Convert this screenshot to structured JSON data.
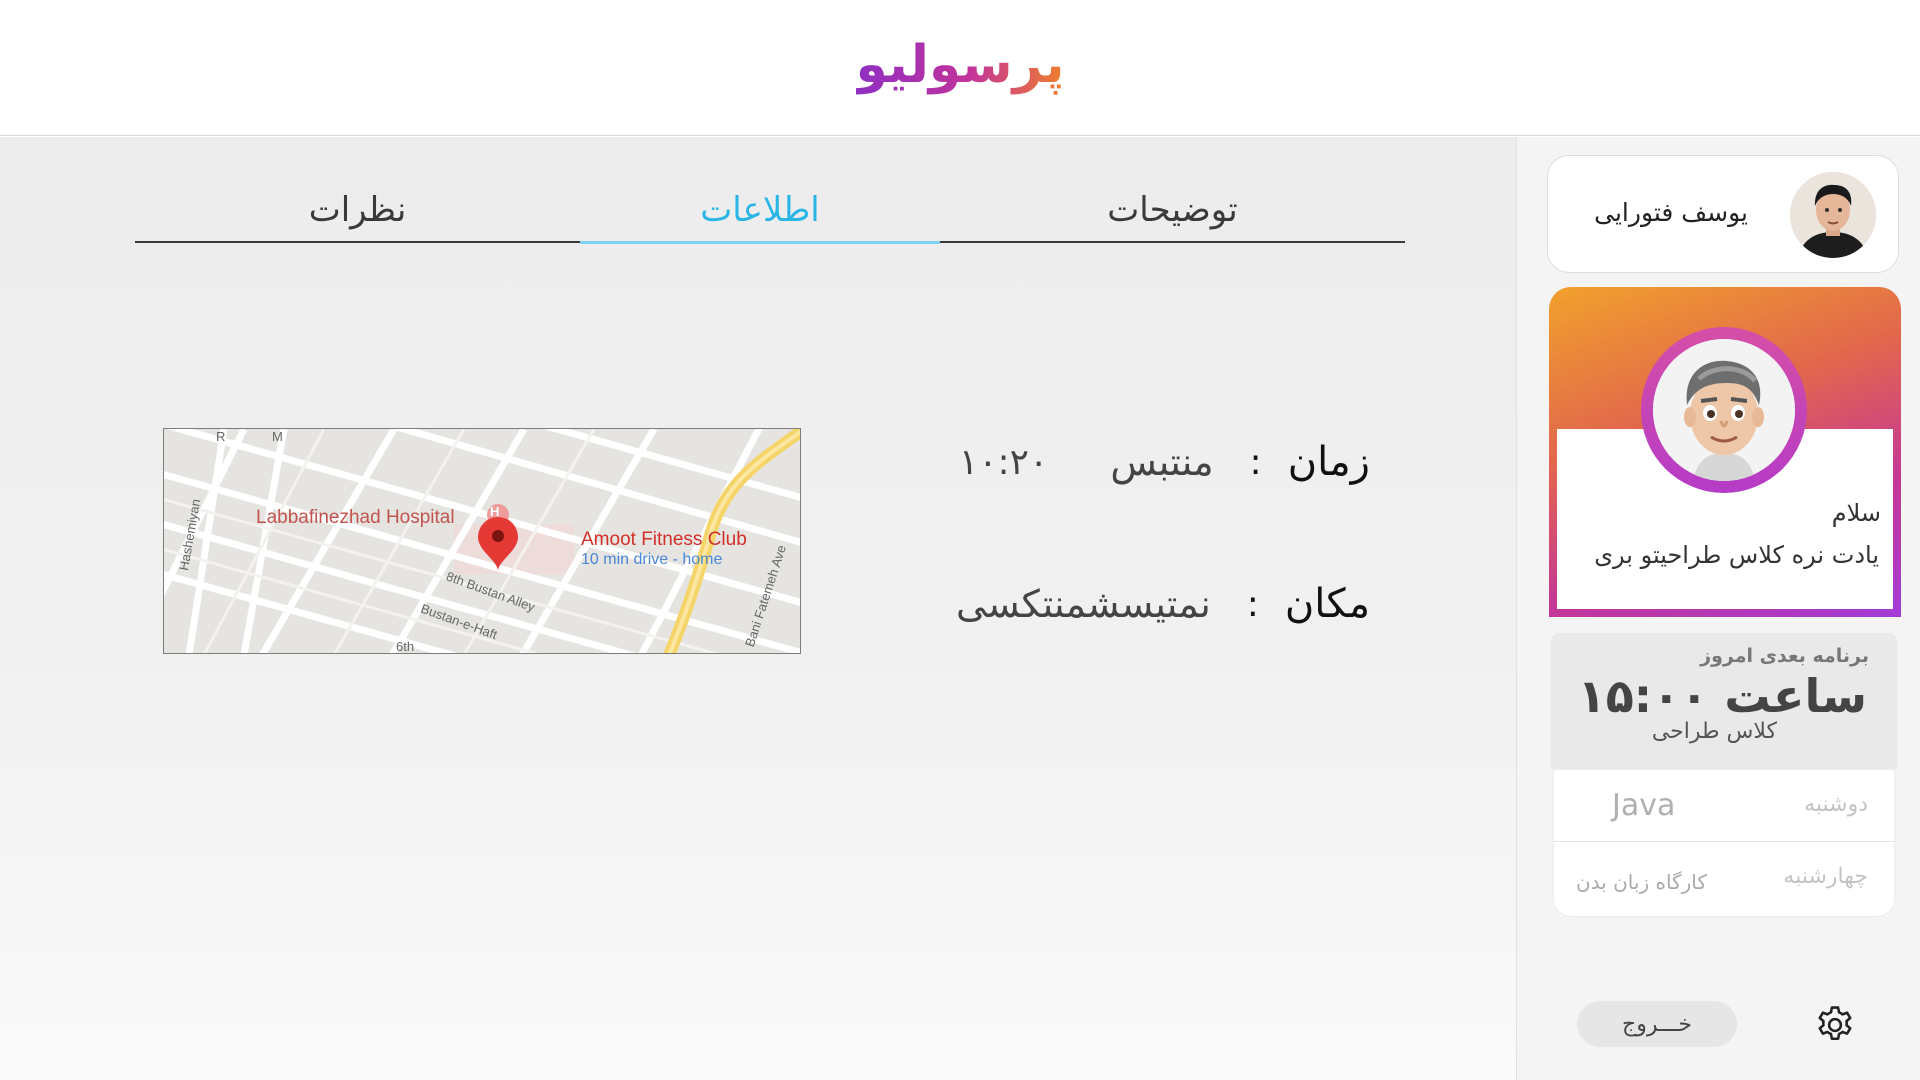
{
  "header": {
    "logo_text": "پرسولیو"
  },
  "tabs": [
    {
      "label": "نظرات"
    },
    {
      "label": "اطلاعات"
    },
    {
      "label": "توضیحات"
    }
  ],
  "info": {
    "time_label": "زمان",
    "time_value": "منتبس",
    "time_clock": "۱۰:۲۰",
    "place_label": "مکان",
    "place_value": "نمتیسشمنتکسی",
    "separator": ":"
  },
  "map": {
    "hospital_label": "Labbafinezhad Hospital",
    "hospital_badge": "H",
    "destination_label": "Amoot Fitness Club",
    "drive_label": "10 min drive - home",
    "streets": [
      "Hashemiyan",
      "8th Bustan Alley",
      "Bustan-e-Haft",
      "Bani Fatemeh Ave",
      "6th",
      "R",
      "M"
    ]
  },
  "sidebar": {
    "user_name": "یوسف فتورایی",
    "promo_hello": "سلام",
    "promo_message": "یادت نره کلاس طراحیتو بری",
    "next_label": "برنامه بعدی امروز",
    "next_time": "ساعت ۱۵:۰۰",
    "next_class": "کلاس طراحی",
    "schedule": [
      {
        "day": "دوشنبه",
        "title": "Java"
      },
      {
        "day": "چهارشنبه",
        "title": "کارگاه زبان بدن"
      }
    ],
    "logout_label": "خـــروج"
  },
  "colors": {
    "active_tab": "#29b6e6",
    "promo_gradient_start": "#f1a12c",
    "promo_gradient_end": "#a43bd8"
  }
}
